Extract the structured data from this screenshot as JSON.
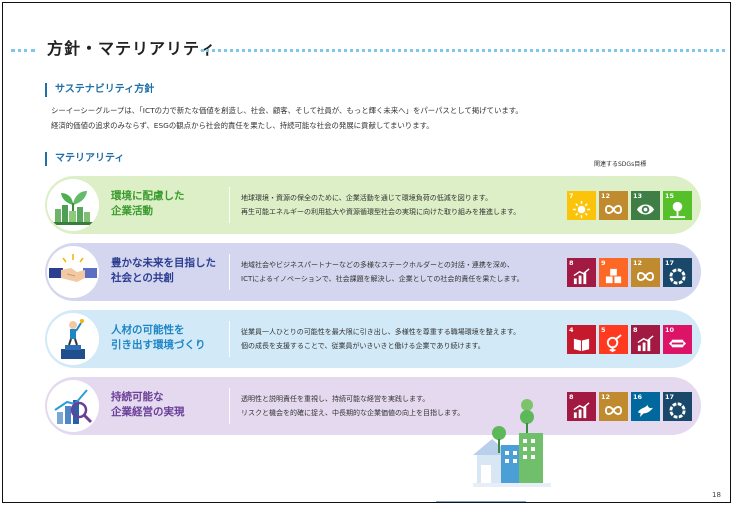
{
  "page": {
    "title": "方針・マテリアリティ",
    "number": "18"
  },
  "sustainability": {
    "heading": "サステナビリティ方針",
    "lines": [
      "シーイーシーグループは、「ICTの力で新たな価値を創造し、社会、顧客、そして社員が、もっと輝く未来へ」をパーパスとして掲げています。",
      "経済的価値の追求のみならず、ESGの観点から社会的責任を果たし、持続可能な社会の発展に貢献してまいります。"
    ]
  },
  "materiality": {
    "heading": "マテリアリティ",
    "sdg_caption": "関連するSDGs目標",
    "items": [
      {
        "name_lines": [
          "環境に配慮した",
          "企業活動"
        ],
        "desc_lines": [
          "地球環境・資源の保全のために、企業活動を通じて環境負荷の低減を図ります。",
          "再生可能エネルギーの利用拡大や資源循環型社会の実現に向けた取り組みを推進します。"
        ],
        "sdgs": [
          {
            "num": "7",
            "color": "#FCC30B",
            "icon": "sun-icon"
          },
          {
            "num": "12",
            "color": "#BF8B2E",
            "icon": "infinity-icon"
          },
          {
            "num": "13",
            "color": "#3F7E44",
            "icon": "eye-icon"
          },
          {
            "num": "15",
            "color": "#56C02B",
            "icon": "tree-icon"
          }
        ]
      },
      {
        "name_lines": [
          "豊かな未来を目指した",
          "社会との共創"
        ],
        "desc_lines": [
          "地域社会やビジネスパートナーなどの多様なステークホルダーとの対話・連携を深め、",
          "ICTによるイノベーションで、社会課題を解決し、企業としての社会的責任を果たします。"
        ],
        "sdgs": [
          {
            "num": "8",
            "color": "#A21942",
            "icon": "chart-icon"
          },
          {
            "num": "9",
            "color": "#FD6925",
            "icon": "cubes-icon"
          },
          {
            "num": "12",
            "color": "#BF8B2E",
            "icon": "infinity-icon"
          },
          {
            "num": "17",
            "color": "#19486A",
            "icon": "ring-icon"
          }
        ]
      },
      {
        "name_lines": [
          "人材の可能性を",
          "引き出す環境づくり"
        ],
        "desc_lines": [
          "従業員一人ひとりの可能性を最大限に引き出し、多様性を尊重する職場環境を整えます。",
          "個の成長を支援することで、従業員がいきいきと働ける企業であり続けます。"
        ],
        "sdgs": [
          {
            "num": "4",
            "color": "#C5192D",
            "icon": "book-icon"
          },
          {
            "num": "5",
            "color": "#FF3A21",
            "icon": "gender-icon"
          },
          {
            "num": "8",
            "color": "#A21942",
            "icon": "chart-icon"
          },
          {
            "num": "10",
            "color": "#DD1367",
            "icon": "equal-icon"
          }
        ]
      },
      {
        "name_lines": [
          "持続可能な",
          "企業経営の実現"
        ],
        "desc_lines": [
          "透明性と説明責任を重視し、持続可能な経営を実践します。",
          "リスクと機会を的確に捉え、中長期的な企業価値の向上を目指します。"
        ],
        "sdgs": [
          {
            "num": "8",
            "color": "#A21942",
            "icon": "chart-icon"
          },
          {
            "num": "12",
            "color": "#BF8B2E",
            "icon": "infinity-icon"
          },
          {
            "num": "16",
            "color": "#00689D",
            "icon": "dove-icon"
          },
          {
            "num": "17",
            "color": "#19486A",
            "icon": "ring-icon"
          }
        ]
      }
    ]
  }
}
